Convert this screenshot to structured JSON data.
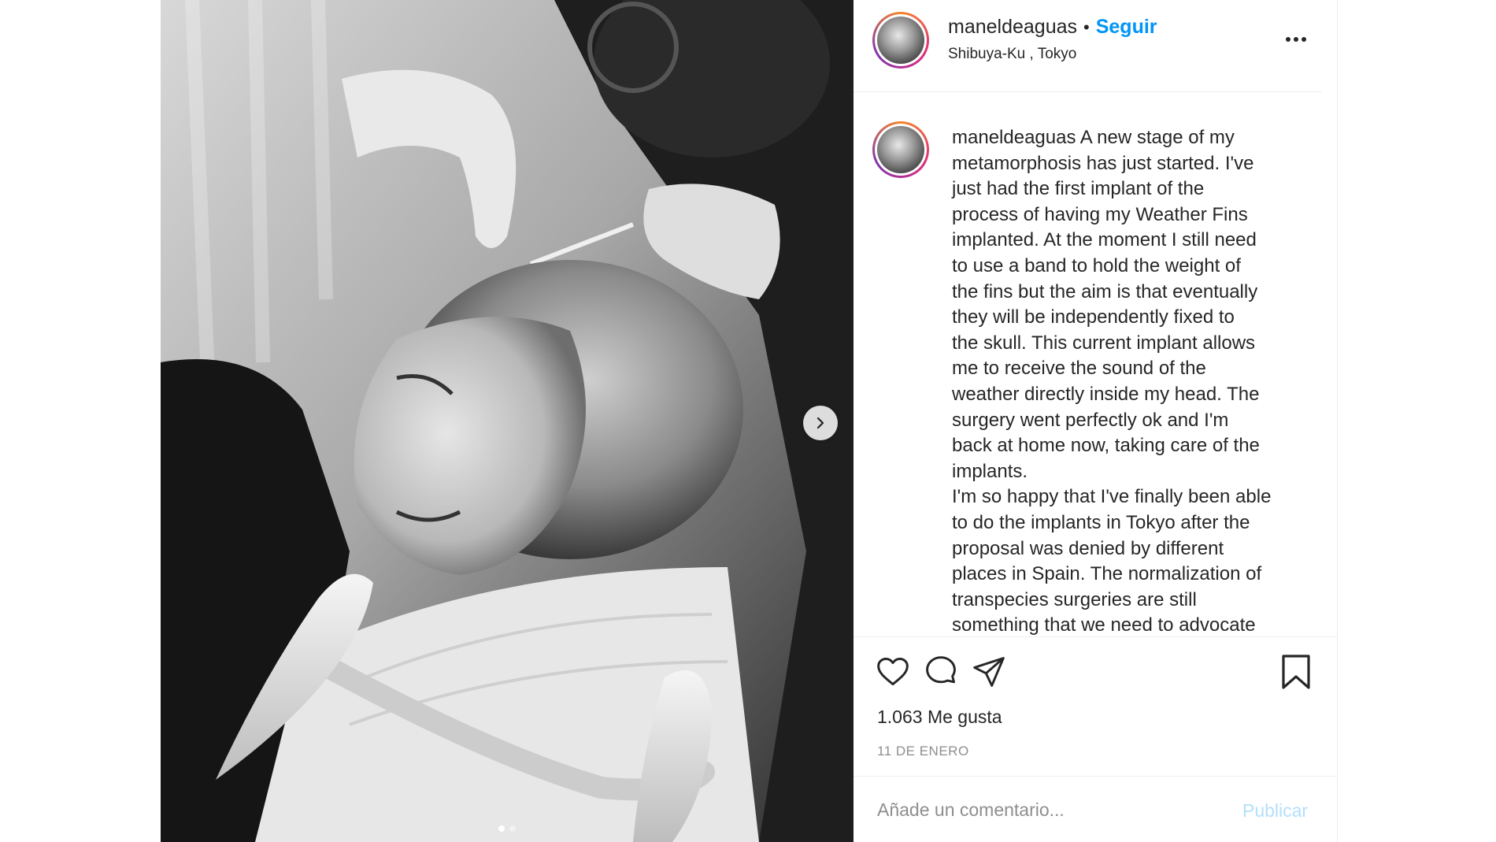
{
  "post": {
    "username": "maneldeaguas",
    "follow_label": "Seguir",
    "bullet": "•",
    "location": "Shibuya-Ku , Tokyo",
    "caption": "A new stage of my\nmetamorphosis has just started. I've\njust had the first implant of the\nprocess of having my Weather Fins\nimplanted. At the moment I still need\nto use a band to hold the weight of\nthe fins but the aim is that eventually\nthey will be independently fixed to\nthe skull. This current implant allows\nme to receive the sound of the\nweather directly inside my head. The\nsurgery went perfectly ok and I'm\nback at home now, taking care of the\nimplants.\nI'm so happy that I've finally been able\nto do the implants in Tokyo after the\nproposal was denied by different\nplaces in Spain. The normalization of\ntranspecies surgeries are still\nsomething that we need to advocate",
    "likes": "1.063 Me gusta",
    "date": "11 DE ENERO"
  },
  "carousel": {
    "current": 1,
    "total": 2
  },
  "comment": {
    "placeholder": "Añade un comentario...",
    "publish_label": "Publicar"
  },
  "icons": {
    "like": "heart-icon",
    "comment": "comment-bubble-icon",
    "share": "paper-plane-icon",
    "save": "bookmark-icon",
    "more": "more-options-icon",
    "next": "chevron-right-icon"
  },
  "colors": {
    "link": "#0095f6",
    "publish_disabled": "#b2dffc",
    "muted": "#8e8e8e",
    "text": "#262626"
  }
}
